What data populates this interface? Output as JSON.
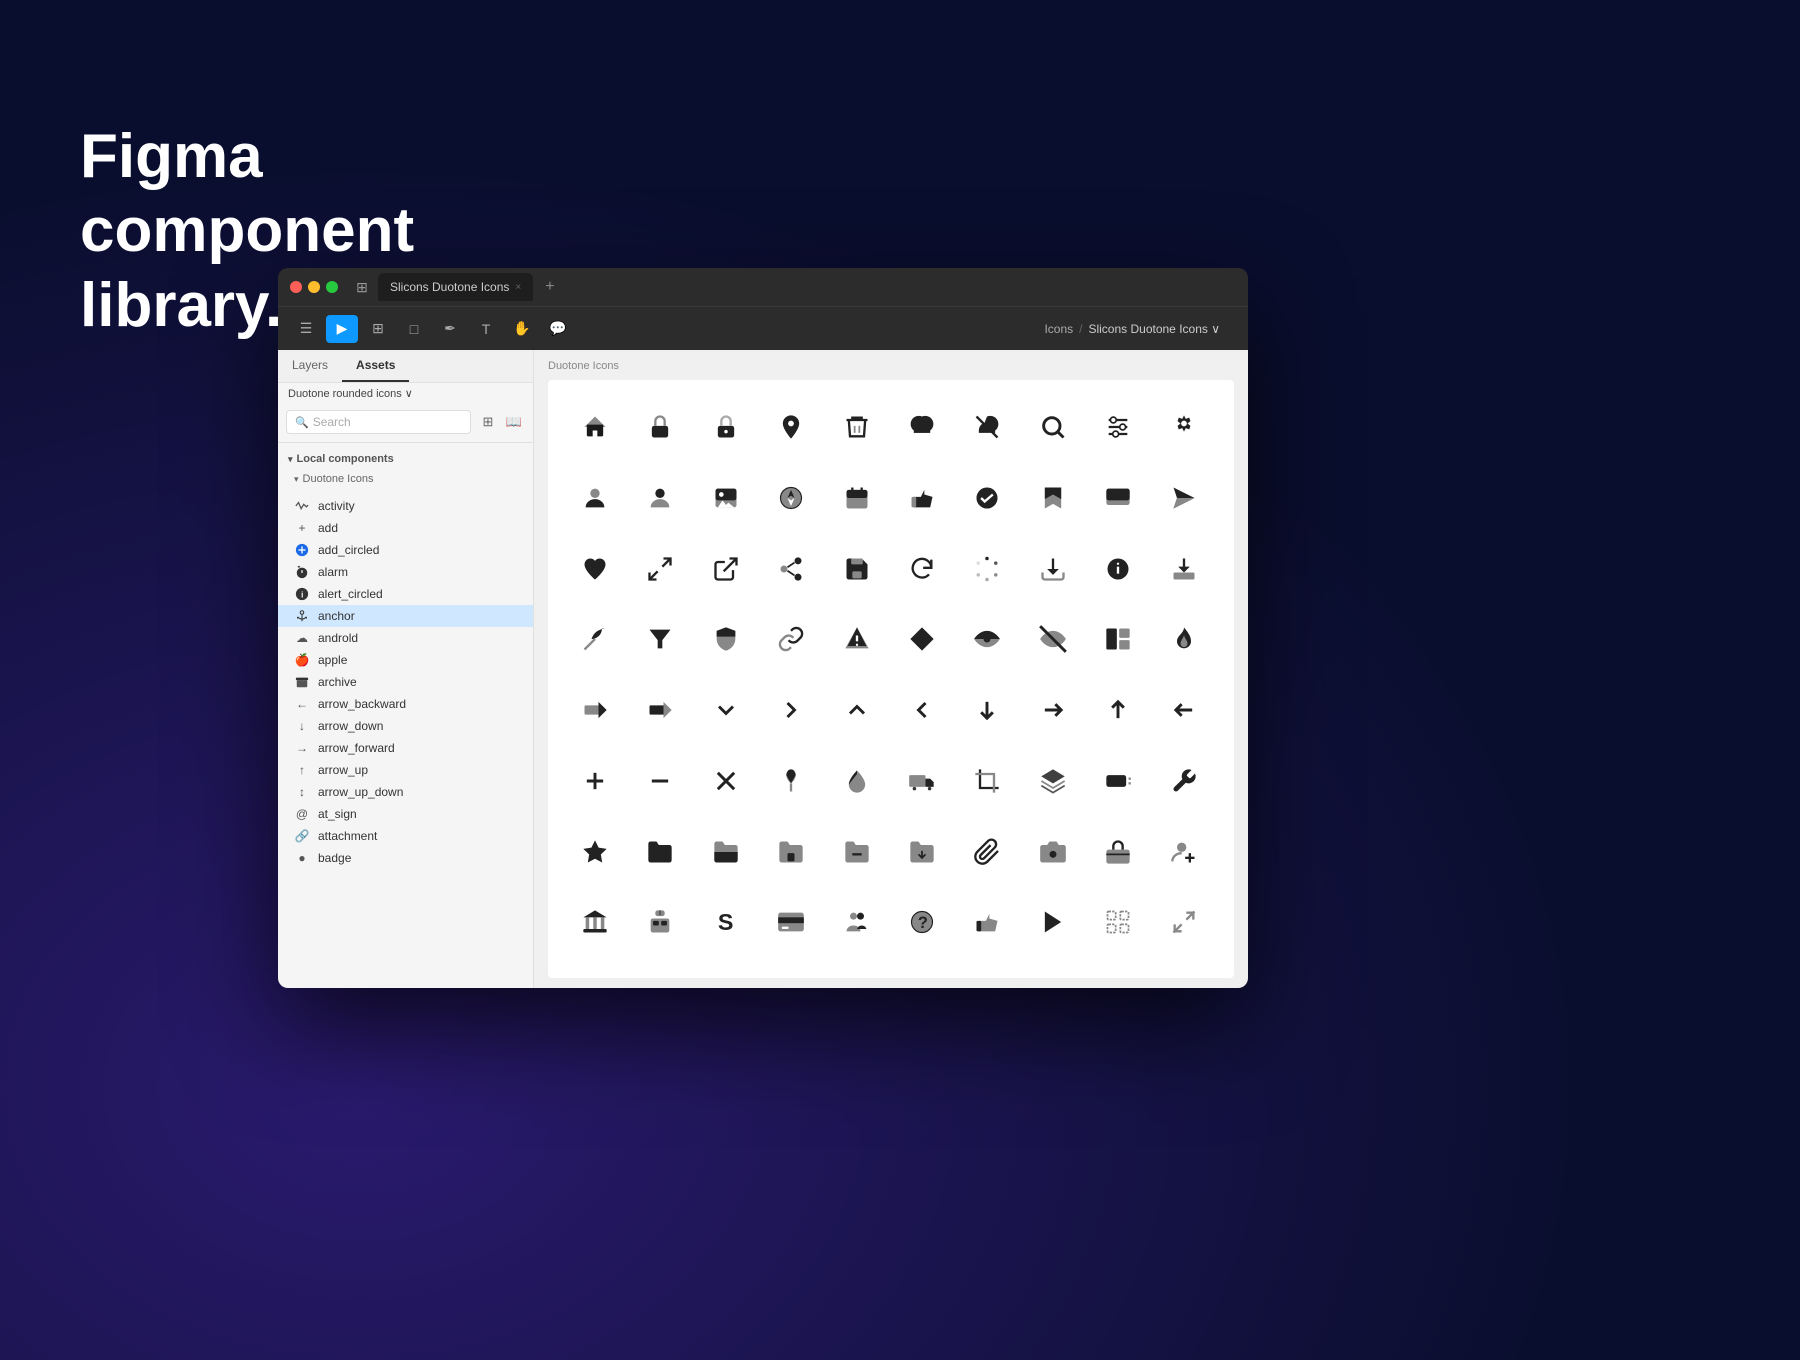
{
  "hero": {
    "title_line1": "Figma component",
    "title_line2": "library."
  },
  "figma": {
    "window_title": "Slicons Duotone Icons",
    "tab_label": "Slicons Duotone Icons",
    "tab_close": "×",
    "tab_add": "+",
    "breadcrumb_parent": "Icons",
    "breadcrumb_sep": "/",
    "breadcrumb_current": "Slicons Duotone Icons ∨",
    "sidebar_tabs": [
      "Layers",
      "Assets"
    ],
    "active_tab": "Assets",
    "dropdown_label": "Duotone rounded icons ∨",
    "search_placeholder": "Search",
    "section_local": "Local components",
    "section_duotone": "Duotone Icons",
    "canvas_label": "Duotone Icons",
    "components": [
      {
        "icon": "〜",
        "name": "activity"
      },
      {
        "icon": "+",
        "name": "add"
      },
      {
        "icon": "⊕",
        "name": "add_circled"
      },
      {
        "icon": "⏰",
        "name": "alarm"
      },
      {
        "icon": "ℹ",
        "name": "alert_circled"
      },
      {
        "icon": "⚓",
        "name": "anchor"
      },
      {
        "icon": "☁",
        "name": "androld"
      },
      {
        "icon": "🍎",
        "name": "apple"
      },
      {
        "icon": "📦",
        "name": "archive"
      },
      {
        "icon": "←",
        "name": "arrow_backward"
      },
      {
        "icon": "↓",
        "name": "arrow_down"
      },
      {
        "icon": "→",
        "name": "arrow_forward"
      },
      {
        "icon": "↑",
        "name": "arrow_up"
      },
      {
        "icon": "↕",
        "name": "arrow_up_down"
      },
      {
        "icon": "@",
        "name": "at_sign"
      },
      {
        "icon": "🔗",
        "name": "attachment"
      },
      {
        "icon": "●",
        "name": "badge"
      }
    ]
  }
}
